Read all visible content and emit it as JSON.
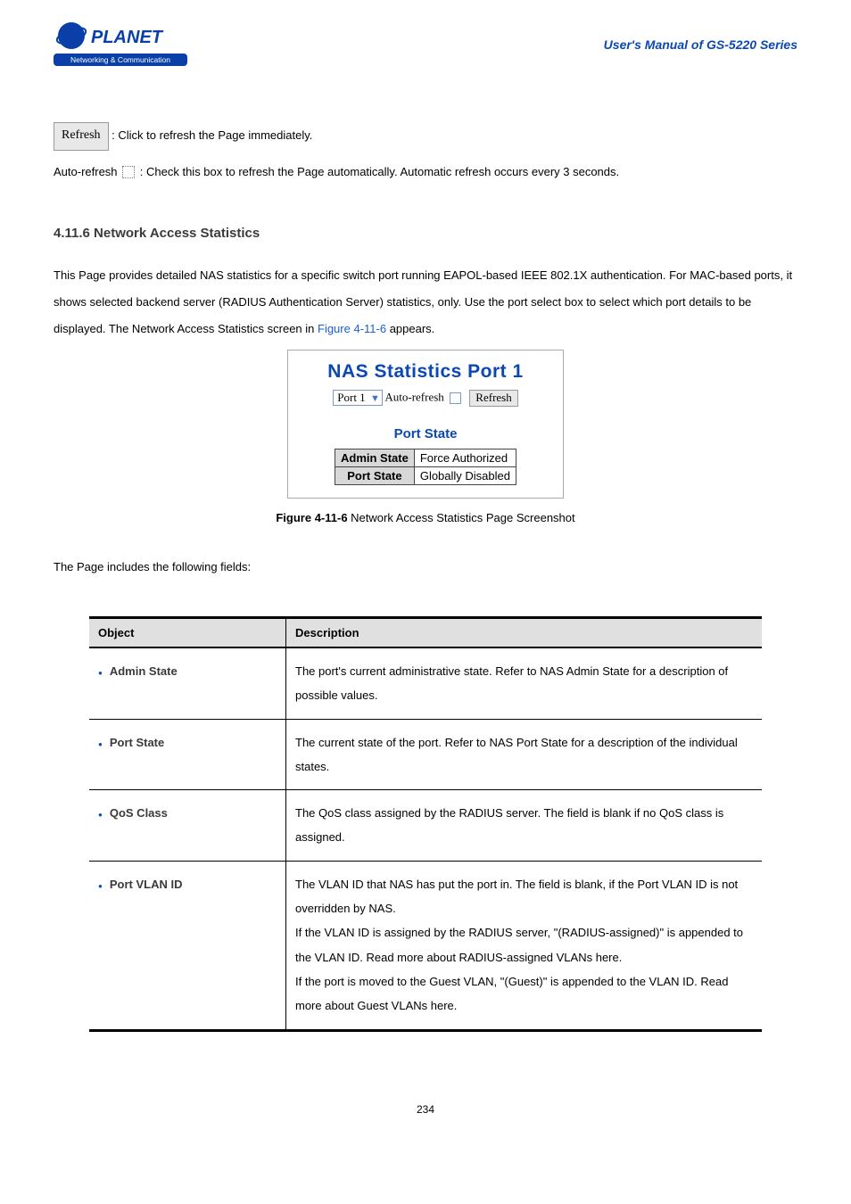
{
  "header": {
    "logo_top": "PLANET",
    "logo_bottom": "Networking & Communication",
    "manual_title": "User's Manual of GS-5220 Series"
  },
  "notes": {
    "refresh_btn": "Refresh",
    "refresh_text": ": Click to refresh the Page immediately.",
    "auto_prefix": "Auto-refresh ",
    "auto_text": ": Check this box to refresh the Page automatically. Automatic refresh occurs every 3 seconds."
  },
  "section": {
    "heading": "4.11.6 Network Access Statistics",
    "para": "This Page provides detailed NAS statistics for a specific switch port running EAPOL-based IEEE 802.1X authentication. For MAC-based ports, it shows selected backend server (RADIUS Authentication Server) statistics, only. Use the port select box to select which port details to be displayed. The Network Access Statistics screen in ",
    "figure_link": "Figure 4-11-6",
    "para_tail": " appears."
  },
  "screenshot": {
    "title": "NAS Statistics Port 1",
    "port_sel": "Port 1",
    "auto_label": "Auto-refresh",
    "refresh_btn": "Refresh",
    "state_heading": "Port State",
    "rows": [
      {
        "label": "Admin State",
        "value": "Force Authorized"
      },
      {
        "label": "Port State",
        "value": "Globally Disabled"
      }
    ]
  },
  "caption": {
    "prefix": "Figure 4-11-6 ",
    "text": "Network Access Statistics Page Screenshot"
  },
  "fields_intro": "The Page includes the following fields:",
  "table": {
    "head_obj": "Object",
    "head_desc": "Description",
    "rows": [
      {
        "obj": "Admin State",
        "desc": "The port's current administrative state. Refer to NAS Admin State for a description of possible values."
      },
      {
        "obj": "Port State",
        "desc": "The current state of the port. Refer to NAS Port State for a description of the individual states."
      },
      {
        "obj": "QoS Class",
        "desc": "The QoS class assigned by the RADIUS server. The field is blank if no QoS class is assigned."
      },
      {
        "obj": "Port VLAN ID",
        "desc": "The VLAN ID that NAS has put the port in. The field is blank, if the Port VLAN ID is not overridden by NAS.\nIf the VLAN ID is assigned by the RADIUS server, \"(RADIUS-assigned)\" is appended to the VLAN ID. Read more about RADIUS-assigned VLANs here.\nIf the port is moved to the Guest VLAN, \"(Guest)\" is appended to the VLAN ID. Read more about Guest VLANs here."
      }
    ]
  },
  "page_number": "234"
}
